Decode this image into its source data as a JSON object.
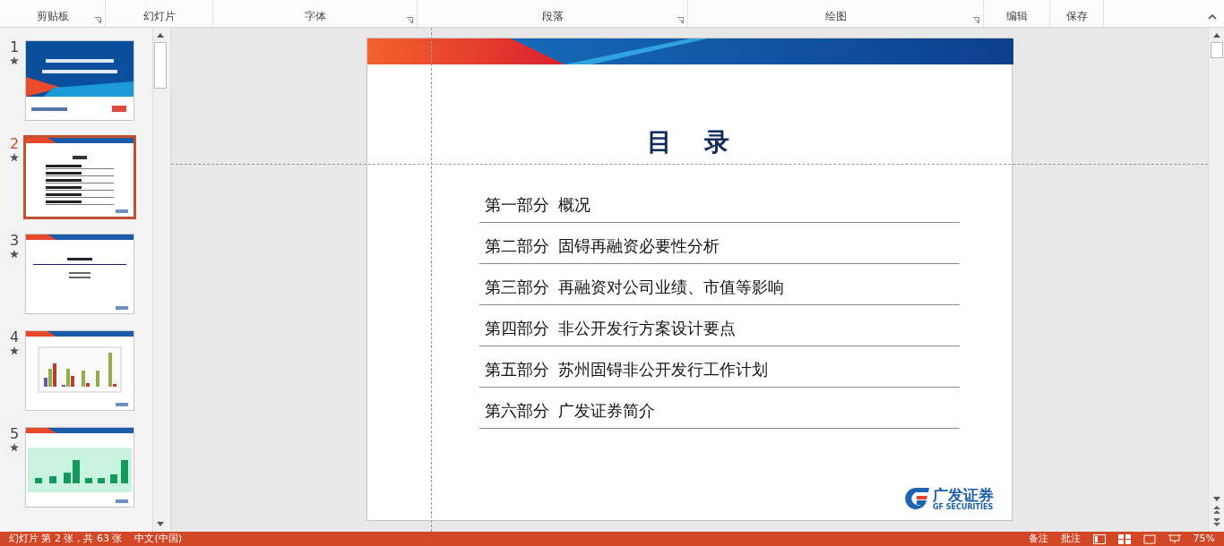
{
  "ribbon": {
    "groups": [
      {
        "label": "剪贴板",
        "launcher": true
      },
      {
        "label": "幻灯片",
        "launcher": false
      },
      {
        "label": "字体",
        "launcher": true
      },
      {
        "label": "段落",
        "launcher": true
      },
      {
        "label": "绘图",
        "launcher": true
      },
      {
        "label": "编辑",
        "launcher": false
      },
      {
        "label": "保存",
        "launcher": false
      }
    ]
  },
  "thumbnails": [
    {
      "number": "1",
      "kind": "cover",
      "selected": false
    },
    {
      "number": "2",
      "kind": "contents",
      "selected": true
    },
    {
      "number": "3",
      "kind": "section",
      "selected": false
    },
    {
      "number": "4",
      "kind": "bar-chart",
      "selected": false
    },
    {
      "number": "5",
      "kind": "green-chart",
      "selected": false
    }
  ],
  "slide": {
    "title": "目　录",
    "items": [
      {
        "part": "第一部分",
        "title": "概况"
      },
      {
        "part": "第二部分",
        "title": "固锝再融资必要性分析"
      },
      {
        "part": "第三部分",
        "title": "再融资对公司业绩、市值等影响"
      },
      {
        "part": "第四部分",
        "title": "非公开发行方案设计要点"
      },
      {
        "part": "第五部分",
        "title": "苏州固锝非公开发行工作计划"
      },
      {
        "part": "第六部分",
        "title": "广发证券简介"
      }
    ],
    "logo": {
      "name": "广发证券",
      "subtitle": "GF SECURITIES"
    }
  },
  "status_bar": {
    "slide_info": "幻灯片 第 2 张，共 63 张",
    "language": "中文(中国)",
    "notes": "备注",
    "comments": "批注",
    "zoom": "75%"
  }
}
